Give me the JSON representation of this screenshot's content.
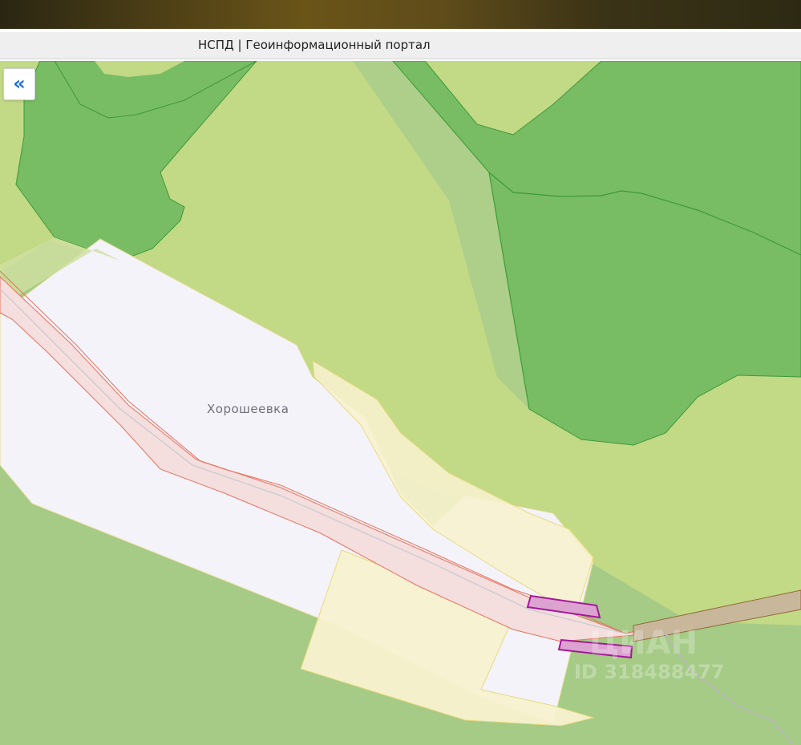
{
  "banner": {
    "accent_color": "#5f4c1a"
  },
  "header": {
    "title": "НСПД | Геоинформационный портал"
  },
  "sidebar_toggle": {
    "icon": "double-chevron-left-icon",
    "glyph": "«"
  },
  "map": {
    "locality_label": "Хорошеевка",
    "watermark_brand": "ЦИАН",
    "watermark_id": "ID 318488477",
    "colors": {
      "forest": "#78bc64",
      "forest_edge": "#3f9a38",
      "meadow": "#c2d985",
      "field": "#a5cb86",
      "settlement": "#f4f3fa",
      "land_plot": "#f8f2cf",
      "land_plot_edge": "#e8d97a",
      "road_zone": "#f4dede",
      "road_edge": "#e9735e",
      "parcel": "#dca3d0",
      "parcel_edge": "#a4199a"
    }
  }
}
